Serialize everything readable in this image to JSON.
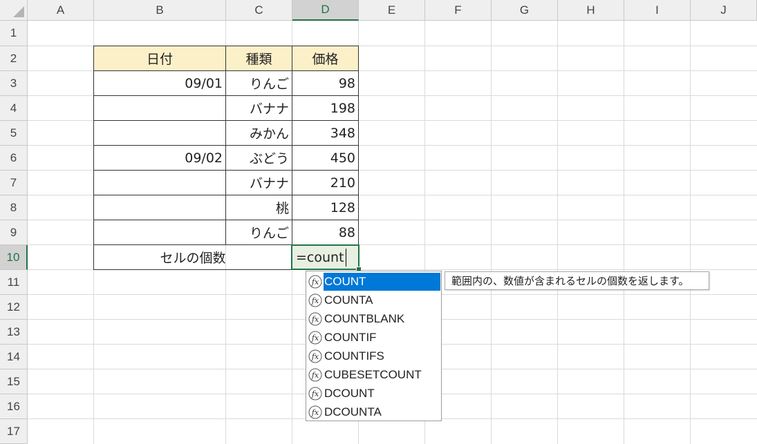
{
  "columns": [
    "A",
    "B",
    "C",
    "D",
    "E",
    "F",
    "G",
    "H",
    "I",
    "J"
  ],
  "rows": [
    "1",
    "2",
    "3",
    "4",
    "5",
    "6",
    "7",
    "8",
    "9",
    "10",
    "11",
    "12",
    "13",
    "14",
    "15",
    "16",
    "17"
  ],
  "selected_column": "D",
  "selected_row": "10",
  "table": {
    "headers": [
      "日付",
      "種類",
      "価格"
    ],
    "data": [
      {
        "date": "09/01",
        "type": "りんご",
        "price": "98"
      },
      {
        "date": "",
        "type": "バナナ",
        "price": "198"
      },
      {
        "date": "",
        "type": "みかん",
        "price": "348"
      },
      {
        "date": "09/02",
        "type": "ぶどう",
        "price": "450"
      },
      {
        "date": "",
        "type": "バナナ",
        "price": "210"
      },
      {
        "date": "",
        "type": "桃",
        "price": "128"
      },
      {
        "date": "",
        "type": "りんご",
        "price": "88"
      }
    ],
    "summary_label": "セルの個数"
  },
  "active_cell": {
    "ref": "D10",
    "input": "=count"
  },
  "autocomplete": {
    "icon": "function-fx-icon",
    "items": [
      "COUNT",
      "COUNTA",
      "COUNTBLANK",
      "COUNTIF",
      "COUNTIFS",
      "CUBESETCOUNT",
      "DCOUNT",
      "DCOUNTA"
    ],
    "selected": "COUNT",
    "tooltip": "範囲内の、数値が含まれるセルの個数を返します。"
  },
  "colors": {
    "header_fill": "#fcf0c9",
    "accent": "#217346",
    "selection": "#0078d7"
  }
}
